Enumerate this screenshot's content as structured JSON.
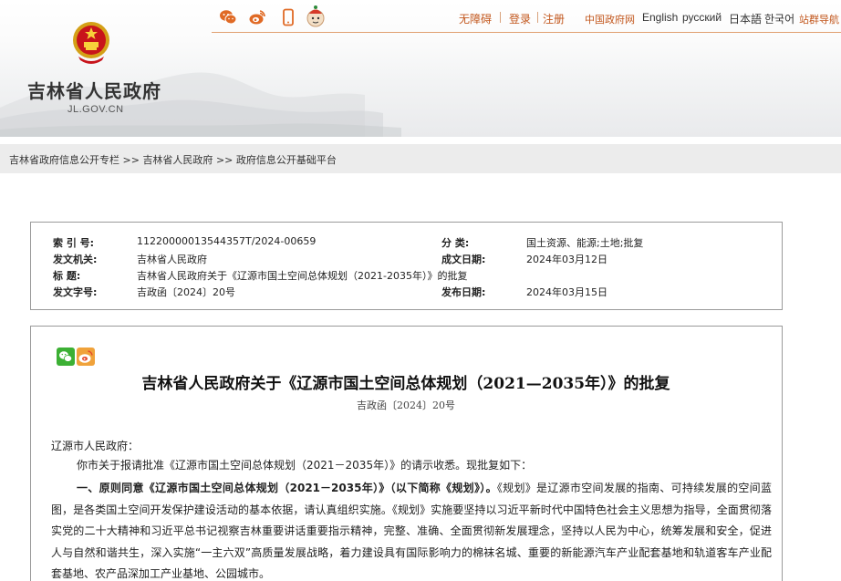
{
  "header": {
    "site_name": "吉林省人民政府",
    "site_domain": "JL.GOV.CN",
    "social_icons": [
      "wechat-icon",
      "weibo-icon",
      "mobile-icon",
      "robot-assistant-icon"
    ],
    "nav": {
      "accessibility": "无障碍",
      "login": "登录",
      "register": "注册",
      "central_gov": "中国政府网",
      "english": "English",
      "russian": "русский",
      "japanese": "日本語",
      "korean": "한국어",
      "ally_sites": "站群导航"
    },
    "accent_color": "#c2571d"
  },
  "breadcrumb": {
    "items": [
      "吉林省政府信息公开专栏",
      "吉林省人民政府",
      "政府信息公开基础平台"
    ],
    "separator": ">>"
  },
  "meta": {
    "index_label": "索 引 号:",
    "index_value": "11220000013544357T/2024-00659",
    "category_label": "分    类:",
    "category_value": "国土资源、能源;土地;批复",
    "issuer_label": "发文机关:",
    "issuer_value": "吉林省人民政府",
    "date_label": "成文日期:",
    "date_value": "2024年03月12日",
    "title_label": "标    题:",
    "title_value": "吉林省人民政府关于《辽源市国土空间总体规划（2021-2035年）》的批复",
    "doc_no_label": "发文字号:",
    "doc_no_value": "吉政函〔2024〕20号",
    "publish_label": "发布日期:",
    "publish_value": "2024年03月15日"
  },
  "article": {
    "share_icons": [
      "wechat-share-icon",
      "weibo-share-icon"
    ],
    "title": "吉林省人民政府关于《辽源市国土空间总体规划（2021—2035年）》的批复",
    "doc_number": "吉政函〔2024〕20号",
    "addressee": "辽源市人民政府：",
    "para1": "你市关于报请批准《辽源市国土空间总体规划（2021－2035年）》的请示收悉。现批复如下：",
    "para2_bold": "一、原则同意《辽源市国土空间总体规划（2021－2035年）》（以下简称《规划》）。",
    "para2_rest": "《规划》是辽源市空间发展的指南、可持续发展的空间蓝图，是各类国土空间开发保护建设活动的基本依据，请认真组织实施。《规划》实施要坚持以习近平新时代中国特色社会主义思想为指导，全面贯彻落实党的二十大精神和习近平总书记视察吉林重要讲话重要指示精神，完整、准确、全面贯彻新发展理念，坚持以人民为中心，统筹发展和安全，促进人与自然和谐共生，深入实施“一主六双”高质量发展战略，着力建设具有国际影响力的棉袜名城、重要的新能源汽车产业配套基地和轨道客车产业配套基地、农产品深加工产业基地、公园城市。"
  }
}
